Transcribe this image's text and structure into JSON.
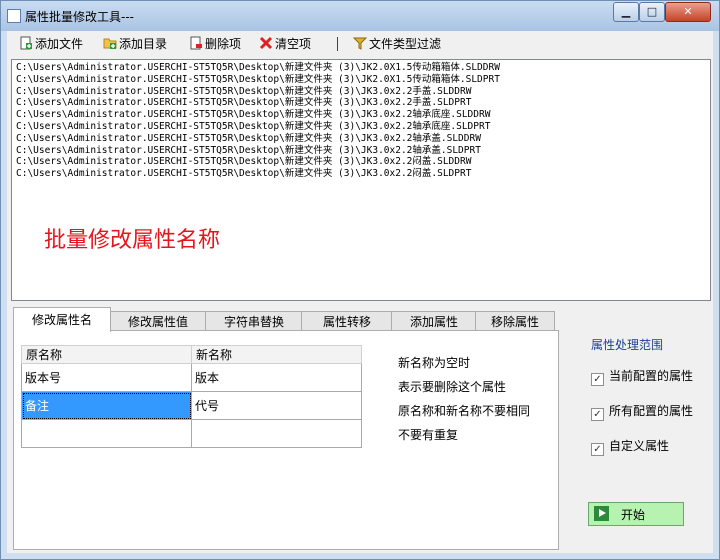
{
  "window": {
    "title": "属性批量修改工具---",
    "min_glyph": "▁",
    "max_glyph": "□",
    "close_glyph": "✕"
  },
  "toolbar": {
    "add_file": "添加文件",
    "add_dir": "添加目录",
    "delete_item": "删除项",
    "clear": "清空项",
    "file_type_filter": "文件类型过滤"
  },
  "file_list": {
    "paths": [
      "C:\\Users\\Administrator.USERCHI-ST5TQ5R\\Desktop\\新建文件夹 (3)\\JK2.0X1.5传动箱箱体.SLDDRW",
      "C:\\Users\\Administrator.USERCHI-ST5TQ5R\\Desktop\\新建文件夹 (3)\\JK2.0X1.5传动箱箱体.SLDPRT",
      "C:\\Users\\Administrator.USERCHI-ST5TQ5R\\Desktop\\新建文件夹 (3)\\JK3.0x2.2手盖.SLDDRW",
      "C:\\Users\\Administrator.USERCHI-ST5TQ5R\\Desktop\\新建文件夹 (3)\\JK3.0x2.2手盖.SLDPRT",
      "C:\\Users\\Administrator.USERCHI-ST5TQ5R\\Desktop\\新建文件夹 (3)\\JK3.0x2.2轴承底座.SLDDRW",
      "C:\\Users\\Administrator.USERCHI-ST5TQ5R\\Desktop\\新建文件夹 (3)\\JK3.0x2.2轴承底座.SLDPRT",
      "C:\\Users\\Administrator.USERCHI-ST5TQ5R\\Desktop\\新建文件夹 (3)\\JK3.0x2.2轴承盖.SLDDRW",
      "C:\\Users\\Administrator.USERCHI-ST5TQ5R\\Desktop\\新建文件夹 (3)\\JK3.0x2.2轴承盖.SLDPRT",
      "C:\\Users\\Administrator.USERCHI-ST5TQ5R\\Desktop\\新建文件夹 (3)\\JK3.0x2.2闷盖.SLDDRW",
      "C:\\Users\\Administrator.USERCHI-ST5TQ5R\\Desktop\\新建文件夹 (3)\\JK3.0x2.2闷盖.SLDPRT"
    ],
    "overlay_text": "批量修改属性名称"
  },
  "tabs": [
    {
      "label": "修改属性名",
      "active": true
    },
    {
      "label": "修改属性值",
      "active": false
    },
    {
      "label": "字符串替换",
      "active": false
    },
    {
      "label": "属性转移",
      "active": false
    },
    {
      "label": "添加属性",
      "active": false
    },
    {
      "label": "移除属性",
      "active": false
    }
  ],
  "rename_table": {
    "headers": [
      "原名称",
      "新名称"
    ],
    "rows": [
      [
        "版本号",
        "版本"
      ],
      [
        "备注",
        "代号"
      ],
      [
        "",
        ""
      ]
    ],
    "selected_cell": "row 2, 原名称"
  },
  "notes": [
    "新名称为空时",
    "表示要删除这个属性",
    "原名称和新名称不要相同",
    "不要有重复"
  ],
  "scope": {
    "title": "属性处理范围",
    "options": [
      {
        "label": "当前配置的属性",
        "checked": true
      },
      {
        "label": "所有配置的属性",
        "checked": true
      },
      {
        "label": "自定义属性",
        "checked": true
      }
    ]
  },
  "start_button": {
    "label": "开始"
  },
  "colors": {
    "accent_red": "#e8141c",
    "selection": "#3399ff",
    "start_bg": "#b7f2b0",
    "scope_title": "#1f3f8f"
  }
}
